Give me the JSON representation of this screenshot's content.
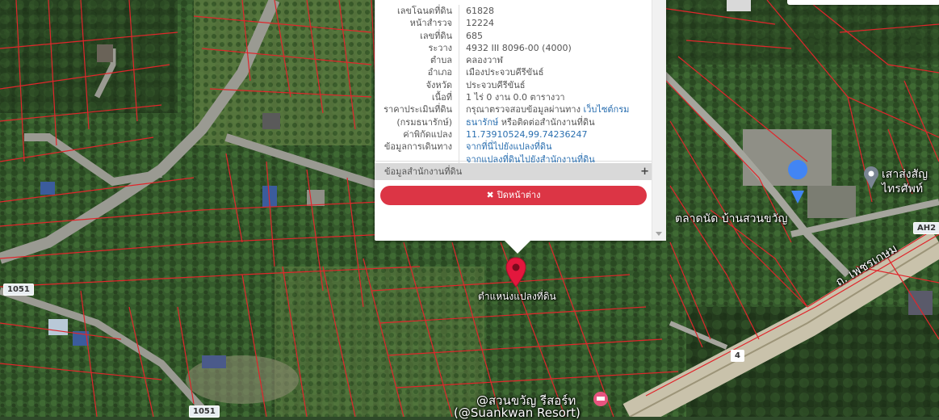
{
  "map": {
    "marker_label": "ตำแหน่งแปลงที่ดิน",
    "place_labels": {
      "market": "ตลาดนัด บ้านสวนขวัญ",
      "tower_line1": "เสาส่งสัญ",
      "tower_line2": "ไทรศัพท์",
      "road_name": "ถ. เพชรเกษม",
      "resort_line1": "@สวนขวัญ รีสอร์ท",
      "resort_line2": "(@Suankwan Resort)"
    },
    "road_badges": {
      "ah2": "AH2",
      "r1051_left": "1051",
      "r1051_bottom": "1051",
      "r4": "4"
    }
  },
  "popup": {
    "rows": [
      {
        "key": "เลขโฉนดที่ดิน",
        "value": "61828"
      },
      {
        "key": "หน้าสำรวจ",
        "value": "12224"
      },
      {
        "key": "เลขที่ดิน",
        "value": "685"
      },
      {
        "key": "ระวาง",
        "value": "4932 III 8096-00 (4000)"
      },
      {
        "key": "ตำบล",
        "value": "คลองวาฬ"
      },
      {
        "key": "อำเภอ",
        "value": "เมืองประจวบคีรีขันธ์"
      },
      {
        "key": "จังหวัด",
        "value": "ประจวบคีรีขันธ์"
      },
      {
        "key": "เนื้อที่",
        "value": "1 ไร่ 0 งาน 0.0 ตารางวา"
      }
    ],
    "price_key_1": "ราคาประเมินที่ดิน",
    "price_key_2": "(กรมธนารักษ์)",
    "price_value_1": "กรุณาตรวจสอบข้อมูลผ่านทาง",
    "price_link_1": "เว็บไซต์กรม",
    "price_link_2": "ธนารักษ์",
    "price_value_2": "หรือติดต่อสำนักงานที่ดิน",
    "coord_key": "ค่าพิกัดแปลง",
    "coord_value": "11.73910524,99.74236247",
    "travel_key": "ข้อมูลการเดินทาง",
    "travel_link_1": "จากที่นี่ไปยังแปลงที่ดิน",
    "travel_link_2": "จากแปลงที่ดินไปยังสำนักงานที่ดิน",
    "section_label": "ข้อมูลสำนักงานที่ดิน",
    "section_toggle": "+",
    "close_label": "ปิดหน้าต่าง",
    "close_icon": "✖"
  },
  "colors": {
    "parcel_line": "#e0262b",
    "close_button": "#dc3545",
    "link": "#2a6fb0",
    "pin": "#e3173d"
  }
}
